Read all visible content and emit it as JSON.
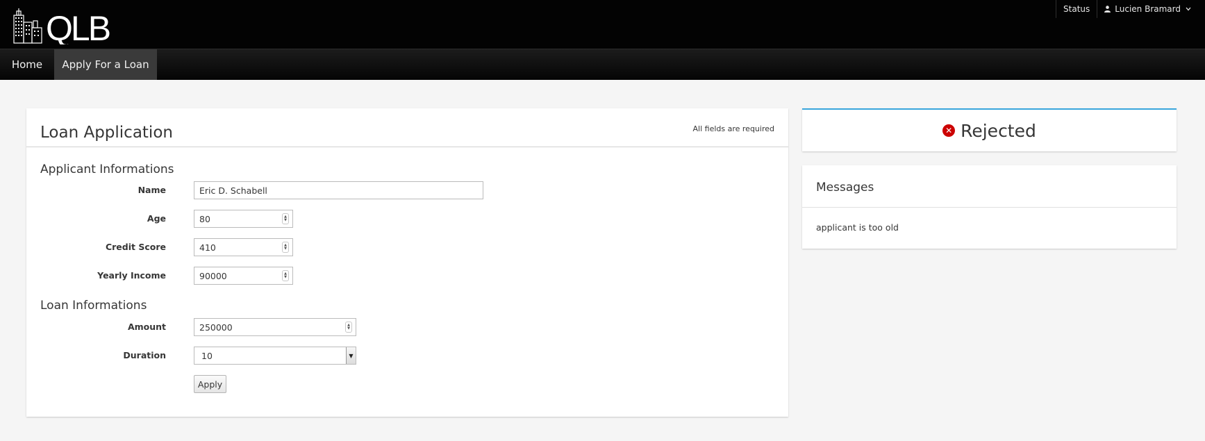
{
  "header": {
    "logo_text": "QLB",
    "status_label": "Status",
    "user_name": "Lucien Bramard"
  },
  "nav": {
    "home": "Home",
    "apply": "Apply For a Loan"
  },
  "form": {
    "title": "Loan Application",
    "required_note": "All fields are required",
    "applicant_section": "Applicant Informations",
    "loan_section": "Loan Informations",
    "fields": {
      "name": {
        "label": "Name",
        "value": "Eric D. Schabell"
      },
      "age": {
        "label": "Age",
        "value": "80"
      },
      "credit_score": {
        "label": "Credit Score",
        "value": "410"
      },
      "yearly_income": {
        "label": "Yearly Income",
        "value": "90000"
      },
      "amount": {
        "label": "Amount",
        "value": "250000"
      },
      "duration": {
        "label": "Duration",
        "value": "10"
      }
    },
    "apply_label": "Apply"
  },
  "status": {
    "text": "Rejected",
    "color": "#cc0000",
    "accent": "#39a5dc"
  },
  "messages": {
    "title": "Messages",
    "items": [
      "applicant is too old"
    ]
  }
}
